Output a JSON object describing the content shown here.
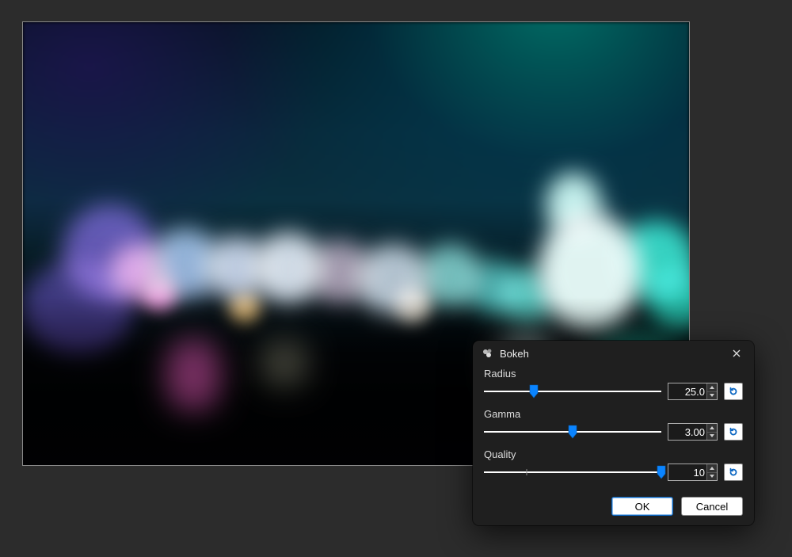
{
  "dialog": {
    "title": "Bokeh",
    "icon_name": "bokeh-icon",
    "params": {
      "radius": {
        "label": "Radius",
        "value": "25.0",
        "min": 0,
        "max": 100,
        "thumb_pct": 28
      },
      "gamma": {
        "label": "Gamma",
        "value": "3.00",
        "min": 0,
        "max": 5,
        "thumb_pct": 50
      },
      "quality": {
        "label": "Quality",
        "value": "10",
        "min": 1,
        "max": 10,
        "thumb_pct": 100,
        "tick_pct": 24
      }
    },
    "buttons": {
      "ok": "OK",
      "cancel": "Cancel"
    }
  },
  "colors": {
    "accent": "#0a84ff",
    "dialog_bg": "#1f1f1f",
    "app_bg": "#2c2c2c"
  }
}
